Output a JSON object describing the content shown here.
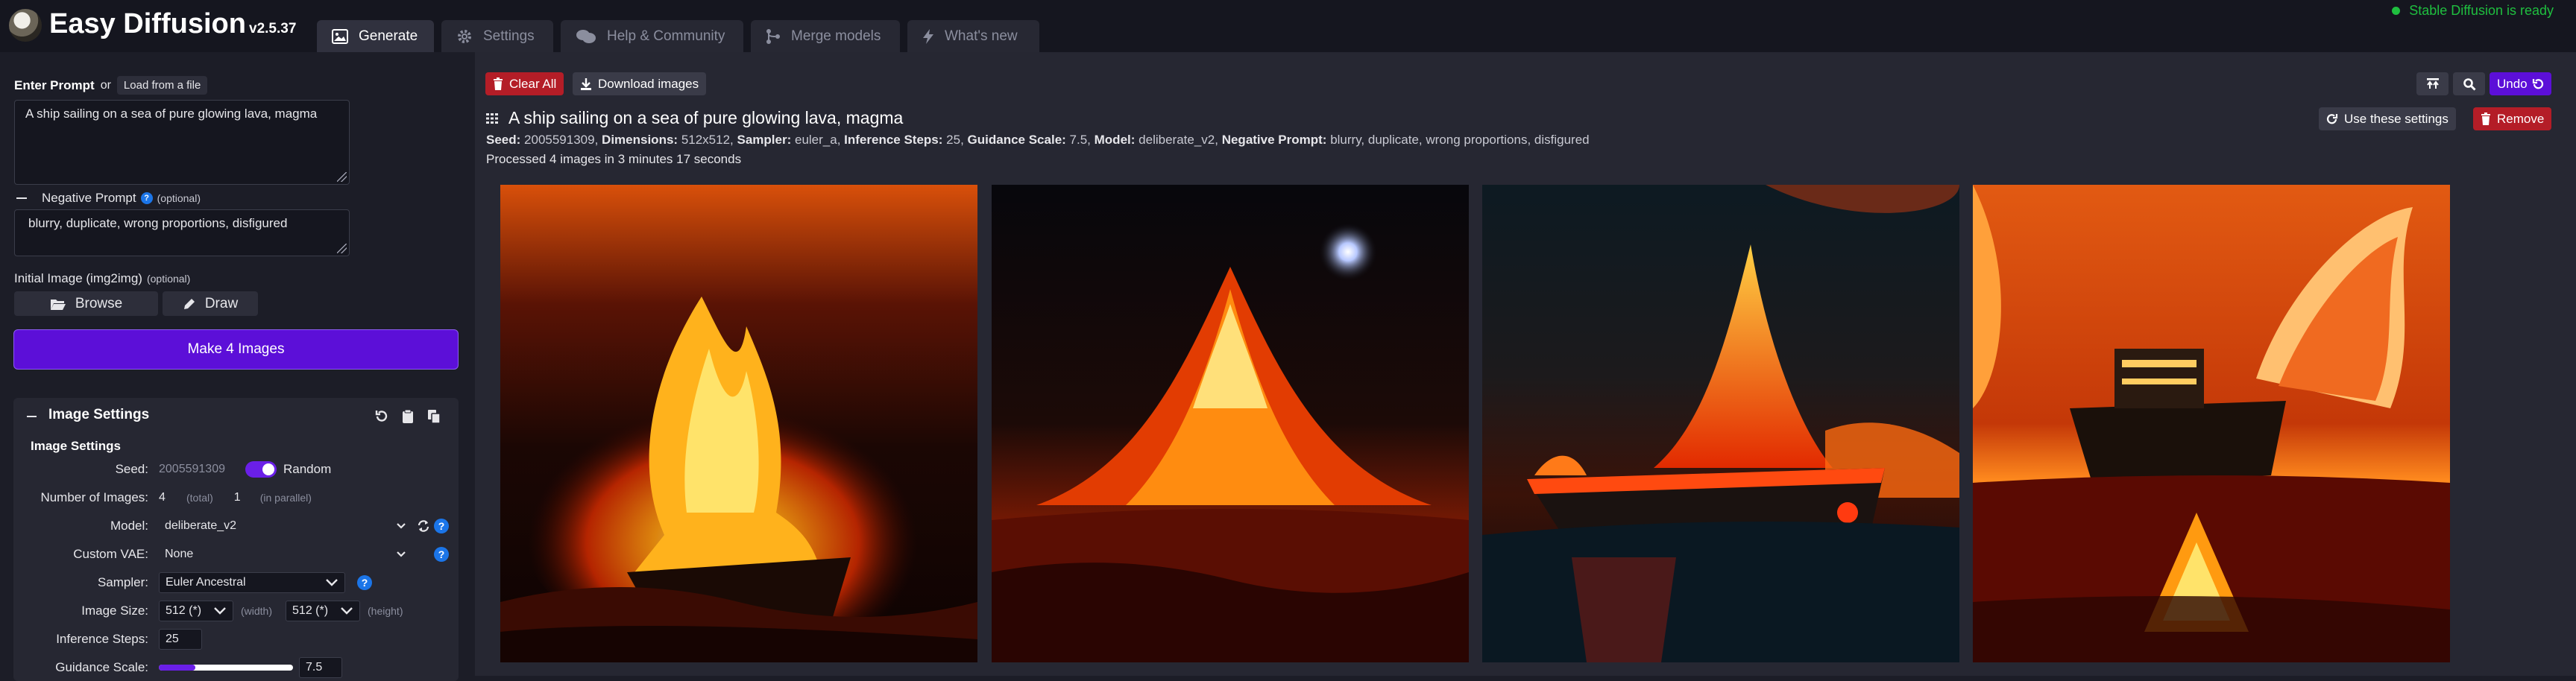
{
  "header": {
    "app_name": "Easy Diffusion",
    "version": "v2.5.37",
    "tabs": [
      {
        "label": "Generate",
        "icon": "image-icon",
        "active": true
      },
      {
        "label": "Settings",
        "icon": "gear-icon",
        "active": false
      },
      {
        "label": "Help & Community",
        "icon": "comments-icon",
        "active": false
      },
      {
        "label": "Merge models",
        "icon": "merge-icon",
        "active": false
      },
      {
        "label": "What's new",
        "icon": "bolt-icon",
        "active": false
      }
    ],
    "status": "Stable Diffusion is ready",
    "status_color": "#1fbf3f"
  },
  "prompt_section": {
    "enter_prompt_label": "Enter Prompt",
    "or_label": "or",
    "load_file_label": "Load from a file",
    "prompt_value": "A ship sailing on a sea of pure glowing lava, magma",
    "negative_label": "Negative Prompt",
    "optional_label": "(optional)",
    "negative_value": "blurry, duplicate, wrong proportions, disfigured",
    "initial_image_label": "Initial Image (img2img)",
    "initial_image_optional": "(optional)",
    "browse_label": "Browse",
    "draw_label": "Draw",
    "make_button_label": "Make 4 Images",
    "make_button_color": "#5c0fd8"
  },
  "image_settings": {
    "panel_title": "Image Settings",
    "subtitle": "Image Settings",
    "seed_label": "Seed:",
    "seed_value": "2005591309",
    "random_label": "Random",
    "random_enabled": true,
    "num_images_label": "Number of Images:",
    "num_images_value": "4",
    "total_hint": "(total)",
    "parallel_value": "1",
    "parallel_hint": "(in parallel)",
    "model_label": "Model:",
    "model_value": "deliberate_v2",
    "vae_label": "Custom VAE:",
    "vae_value": "None",
    "sampler_label": "Sampler:",
    "sampler_value": "Euler Ancestral",
    "image_size_label": "Image Size:",
    "width_value": "512 (*)",
    "width_hint": "(width)",
    "height_value": "512 (*)",
    "height_hint": "(height)",
    "steps_label": "Inference Steps:",
    "steps_value": "25",
    "guidance_label": "Guidance Scale:",
    "guidance_value": "7.5",
    "guidance_fill_fraction": 0.27
  },
  "results": {
    "clear_all_label": "Clear All",
    "download_label": "Download images",
    "undo_label": "Undo",
    "prompt_title": "A ship sailing on a sea of pure glowing lava, magma",
    "use_settings_label": "Use these settings",
    "remove_label": "Remove",
    "meta": {
      "seed_key": "Seed:",
      "seed": "2005591309,",
      "dimensions_key": "Dimensions:",
      "dimensions": "512x512,",
      "sampler_key": "Sampler:",
      "sampler": "euler_a,",
      "steps_key": "Inference Steps:",
      "steps": "25,",
      "guidance_key": "Guidance Scale:",
      "guidance": "7.5,",
      "model_key": "Model:",
      "model": "deliberate_v2,",
      "negative_key": "Negative Prompt:",
      "negative": "blurry, duplicate, wrong proportions, disfigured"
    },
    "processed_text": "Processed 4 images in 3 minutes 17 seconds",
    "images": [
      {
        "name": "lava-ship-image-1"
      },
      {
        "name": "lava-ship-image-2"
      },
      {
        "name": "lava-ship-image-3"
      },
      {
        "name": "lava-ship-image-4"
      }
    ]
  }
}
